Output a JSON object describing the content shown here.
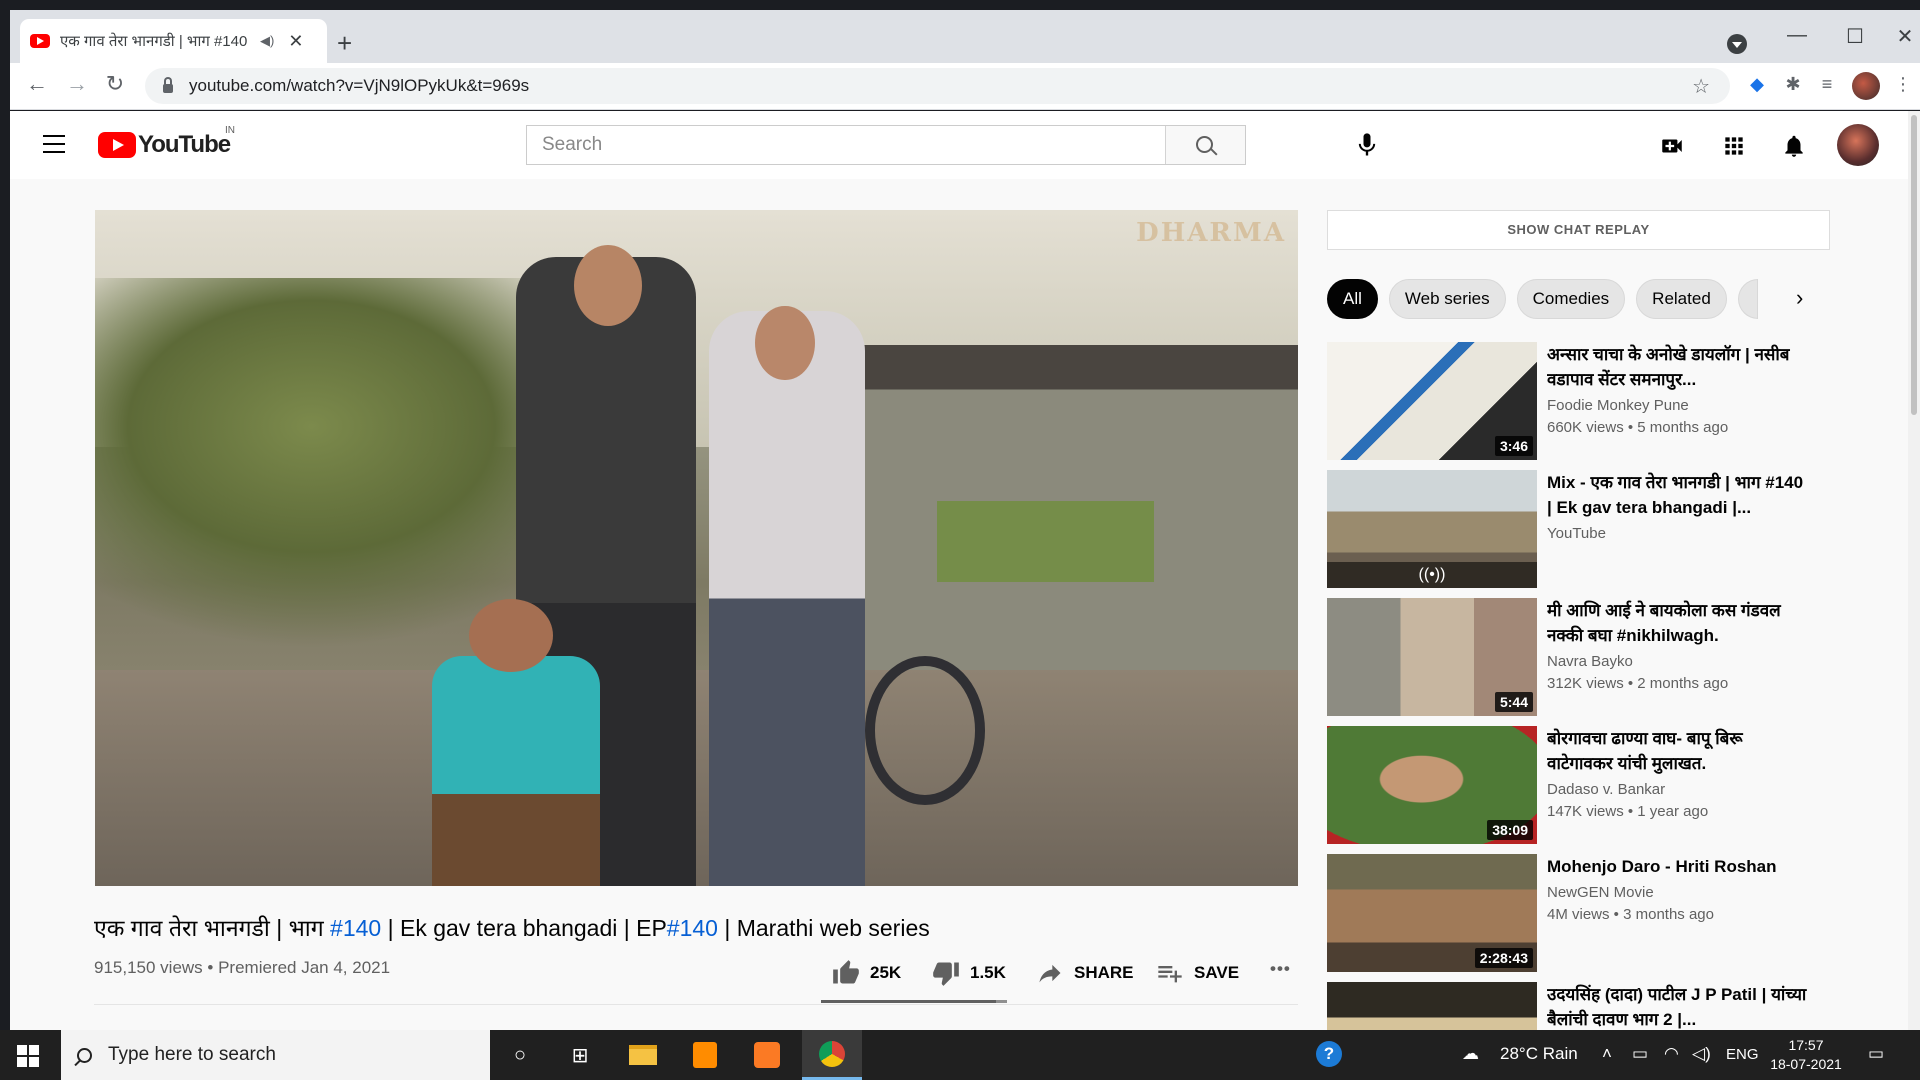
{
  "browser": {
    "tab": {
      "title": "एक गाव तेरा भानगडी | भाग #140",
      "close": "✕"
    },
    "new_tab": "+",
    "window_controls": {
      "minimize": "—",
      "maximize": "☐",
      "close": "✕"
    },
    "nav": {
      "back": "←",
      "forward": "→",
      "reload": "↻"
    },
    "url": "youtube.com/watch?v=VjN9lOPykUk&t=969s",
    "bookmark_star": "☆"
  },
  "youtube": {
    "logo_text": "YouTube",
    "country_code": "IN",
    "search_placeholder": "Search",
    "video": {
      "title_parts": [
        "एक गाव तेरा भानगडी | भाग ",
        "#140",
        " | Ek gav tera bhangadi | EP",
        "#140",
        " | Marathi web series"
      ],
      "watermark": "DHARMA",
      "views": "915,150 views • Premiered Jan 4, 2021",
      "likes": "25K",
      "dislikes": "1.5K",
      "share_label": "SHARE",
      "save_label": "SAVE",
      "more_label": "•••",
      "like_ratio": 0.94
    },
    "sidebar": {
      "chat_replay": "SHOW CHAT REPLAY",
      "chips": [
        "All",
        "Web series",
        "Comedies",
        "Related"
      ],
      "chip_next": "›",
      "recommendations": [
        {
          "title": "अन्सार चाचा के अनोखे डायलॉग | नसीब वडापाव सेंटर समनापुर...",
          "channel": "Foodie Monkey Pune",
          "meta": "660K views • 5 months ago",
          "duration": "3:46"
        },
        {
          "title": "Mix - एक गाव तेरा भानगडी | भाग #140 | Ek gav tera bhangadi |...",
          "channel": "YouTube",
          "meta": "",
          "duration": "",
          "live": "((•))"
        },
        {
          "title": "मी आणि आई ने बायकोला कस गंडवल नक्की बघा #nikhilwagh.",
          "channel": "Navra Bayko",
          "meta": "312K views • 2 months ago",
          "duration": "5:44"
        },
        {
          "title": "बोरगावचा ढाण्या वाघ- बापू बिरू वाटेगावकर यांची मुलाखत.",
          "channel": "Dadaso v. Bankar",
          "meta": "147K views • 1 year ago",
          "duration": "38:09"
        },
        {
          "title": "Mohenjo Daro - Hriti Roshan",
          "channel": "NewGEN Movie",
          "meta": "4M views • 3 months ago",
          "duration": "2:28:43"
        },
        {
          "title": "उदयसिंह (दादा) पाटील J P Patil | यांच्या बैलांची दावण भाग 2 |...",
          "channel": "",
          "meta": "",
          "duration": ""
        }
      ]
    }
  },
  "taskbar": {
    "search_placeholder": "Type here to search",
    "weather": "28°C  Rain",
    "language": "ENG",
    "time": "17:57",
    "date": "18-07-2021"
  },
  "colors": {
    "youtube_red": "#ff0000",
    "link_blue": "#065fd4",
    "taskbar": "#202020"
  }
}
